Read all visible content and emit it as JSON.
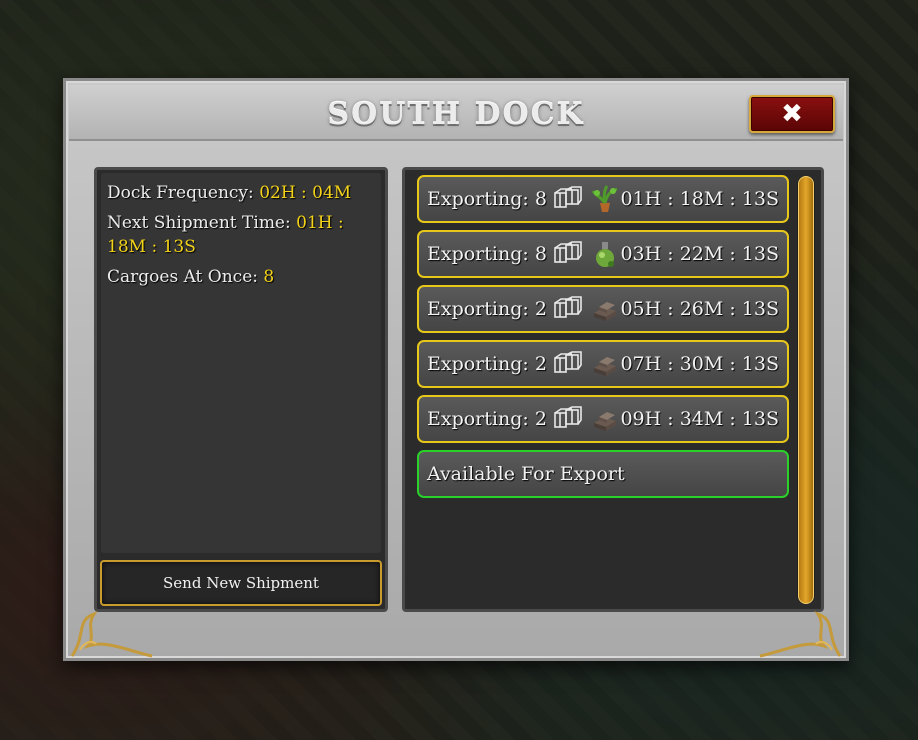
{
  "dialog": {
    "title": "SOUTH DOCK",
    "close_label": "✖"
  },
  "info": {
    "frequency_label": "Dock Frequency:",
    "frequency_value": "02H : 04M",
    "next_label": "Next Shipment Time:",
    "next_value": "01H : 18M : 13S",
    "cargoes_label": "Cargoes At Once:",
    "cargoes_value": "8"
  },
  "send_button_label": "Send New Shipment",
  "exports": [
    {
      "label": "Exporting: 8",
      "goods_icon": "plant-pot-icon",
      "time": "01H : 18M : 13S"
    },
    {
      "label": "Exporting: 8",
      "goods_icon": "potion-bottle-icon",
      "time": "03H : 22M : 13S"
    },
    {
      "label": "Exporting: 2",
      "goods_icon": "iron-ingots-icon",
      "time": "05H : 26M : 13S"
    },
    {
      "label": "Exporting: 2",
      "goods_icon": "iron-ingots-icon",
      "time": "07H : 30M : 13S"
    },
    {
      "label": "Exporting: 2",
      "goods_icon": "iron-ingots-icon",
      "time": "09H : 34M : 13S"
    }
  ],
  "available_label": "Available For Export",
  "colors": {
    "value_yellow": "#f3d21a",
    "row_border": "#e7c71a",
    "available_border": "#2ad12a",
    "close_red": "#8a1010"
  }
}
